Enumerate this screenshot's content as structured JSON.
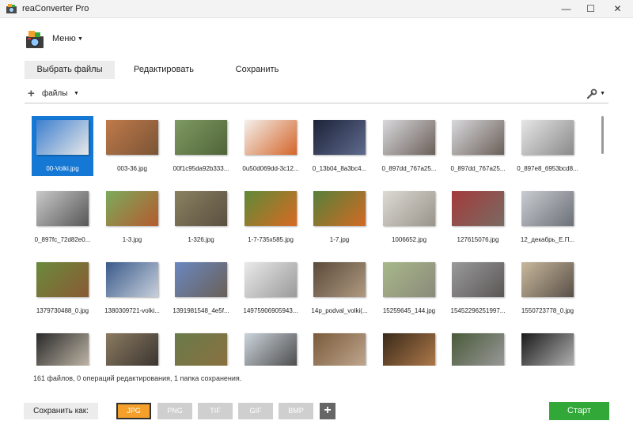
{
  "window": {
    "title": "reaConverter Pro",
    "minimize_glyph": "—",
    "maximize_glyph": "☐",
    "close_glyph": "✕"
  },
  "menu": {
    "label": "Меню"
  },
  "tabs": [
    {
      "label": "Выбрать файлы",
      "active": true
    },
    {
      "label": "Редактировать",
      "active": false
    },
    {
      "label": "Сохранить",
      "active": false
    }
  ],
  "toolbar": {
    "add_glyph": "+",
    "files_label": "файлы"
  },
  "files": [
    {
      "name": "00-Volki.jpg",
      "selected": true,
      "colors": [
        "#3d7fcf",
        "#e8e8e8"
      ]
    },
    {
      "name": "003-36.jpg",
      "colors": [
        "#c07a4a",
        "#7a5436"
      ]
    },
    {
      "name": "00f1c95da92b333...",
      "colors": [
        "#7f9a62",
        "#4f6438"
      ]
    },
    {
      "name": "0u50d069dd-3c12...",
      "colors": [
        "#f4f0ec",
        "#d4652a"
      ]
    },
    {
      "name": "0_13b04_8a3bc4...",
      "colors": [
        "#1c2238",
        "#5f6b8e"
      ]
    },
    {
      "name": "0_897dd_767a25...",
      "colors": [
        "#d8d8dc",
        "#6b6059"
      ]
    },
    {
      "name": "0_897dd_767a25...",
      "colors": [
        "#d8d8dc",
        "#6b6059"
      ]
    },
    {
      "name": "0_897e8_6953bcd8...",
      "colors": [
        "#e6e6e6",
        "#8a8a8a"
      ]
    },
    {
      "name": "0_897fc_72d82e0...",
      "colors": [
        "#c9c9c9",
        "#575757"
      ]
    },
    {
      "name": "1-3.jpg",
      "colors": [
        "#7bab5c",
        "#b55a2e"
      ]
    },
    {
      "name": "1-326.jpg",
      "colors": [
        "#8a8060",
        "#5a5040"
      ]
    },
    {
      "name": "1-7-735x585.jpg",
      "colors": [
        "#5e8a38",
        "#d86a22"
      ]
    },
    {
      "name": "1-7.jpg",
      "colors": [
        "#56803a",
        "#d36a24"
      ]
    },
    {
      "name": "1006652.jpg",
      "colors": [
        "#dcdad4",
        "#9a948a"
      ]
    },
    {
      "name": "127615076.jpg",
      "colors": [
        "#a33b3b",
        "#7a6a62"
      ]
    },
    {
      "name": "12_декабрь_Е.П...",
      "colors": [
        "#c9ccd0",
        "#6c7078"
      ]
    },
    {
      "name": "1379730488_0.jpg",
      "colors": [
        "#6a8a3c",
        "#8a5a34"
      ]
    },
    {
      "name": "1380309721-volki...",
      "colors": [
        "#3a5a8a",
        "#c8d0dc"
      ]
    },
    {
      "name": "1391981548_4e5f...",
      "colors": [
        "#6a88c0",
        "#6a6058"
      ]
    },
    {
      "name": "14975906905943...",
      "colors": [
        "#eaeaea",
        "#9a9a9a"
      ]
    },
    {
      "name": "14p_podval_volki(...",
      "colors": [
        "#5a4a3a",
        "#b09a80"
      ]
    },
    {
      "name": "15259645_144.jpg",
      "colors": [
        "#a8b88a",
        "#8a8a7a"
      ]
    },
    {
      "name": "15452296251997...",
      "colors": [
        "#9a9a9a",
        "#5a5656"
      ]
    },
    {
      "name": "1550723778_0.jpg",
      "colors": [
        "#c8b89c",
        "#5a5048"
      ]
    },
    {
      "name": "",
      "colors": [
        "#2a2a2a",
        "#c2b8a8"
      ]
    },
    {
      "name": "",
      "colors": [
        "#8a7a60",
        "#3a3430"
      ]
    },
    {
      "name": "",
      "colors": [
        "#6a7a4a",
        "#8a7040"
      ]
    },
    {
      "name": "",
      "colors": [
        "#ccd4dc",
        "#4a4a4a"
      ]
    },
    {
      "name": "",
      "colors": [
        "#7a5a3a",
        "#c0a890"
      ]
    },
    {
      "name": "",
      "colors": [
        "#3a2a1a",
        "#b07a4a"
      ]
    },
    {
      "name": "",
      "colors": [
        "#4a5a3a",
        "#9a9a9a"
      ]
    },
    {
      "name": "",
      "colors": [
        "#1a1a1a",
        "#b4b4b4"
      ]
    }
  ],
  "status": "161 файлов, 0 операций редактирования, 1 папка сохранения.",
  "footer": {
    "save_as_label": "Сохранить как:",
    "formats": [
      {
        "label": "JPG",
        "active": true
      },
      {
        "label": "PNG",
        "active": false
      },
      {
        "label": "TIF",
        "active": false
      },
      {
        "label": "GIF",
        "active": false
      },
      {
        "label": "BMP",
        "active": false
      }
    ],
    "add_format_glyph": "+",
    "start_label": "Старт"
  }
}
